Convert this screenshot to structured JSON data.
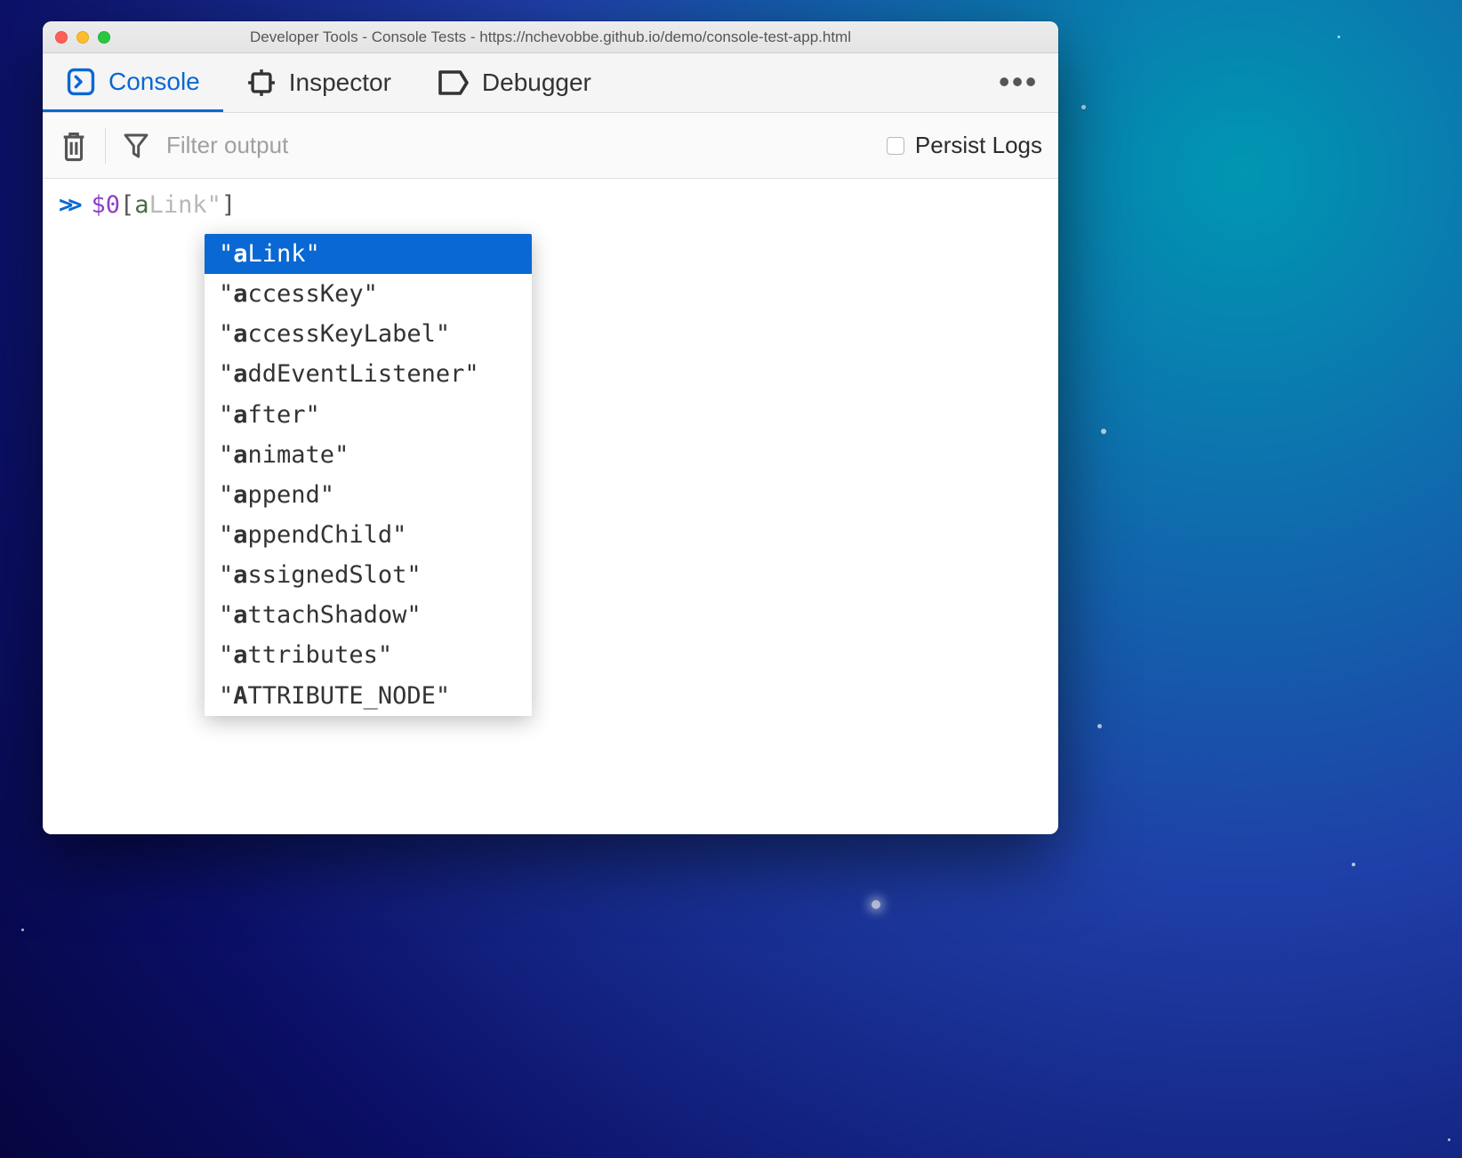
{
  "window": {
    "title": "Developer Tools - Console Tests - https://nchevobbe.github.io/demo/console-test-app.html"
  },
  "tabs": {
    "console": {
      "label": "Console"
    },
    "inspector": {
      "label": "Inspector"
    },
    "debugger": {
      "label": "Debugger"
    }
  },
  "toolbar": {
    "filter_placeholder": "Filter output",
    "persist_label": "Persist Logs"
  },
  "prompt": {
    "var": "$0",
    "open_bracket": "[",
    "typed": "a",
    "ghost": "Link\"",
    "close_bracket": "]"
  },
  "autocomplete": {
    "match_prefix": "a",
    "options": [
      {
        "label": "aLink",
        "selected": true
      },
      {
        "label": "accessKey",
        "selected": false
      },
      {
        "label": "accessKeyLabel",
        "selected": false
      },
      {
        "label": "addEventListener",
        "selected": false
      },
      {
        "label": "after",
        "selected": false
      },
      {
        "label": "animate",
        "selected": false
      },
      {
        "label": "append",
        "selected": false
      },
      {
        "label": "appendChild",
        "selected": false
      },
      {
        "label": "assignedSlot",
        "selected": false
      },
      {
        "label": "attachShadow",
        "selected": false
      },
      {
        "label": "attributes",
        "selected": false
      },
      {
        "label": "ATTRIBUTE_NODE",
        "selected": false
      }
    ]
  }
}
